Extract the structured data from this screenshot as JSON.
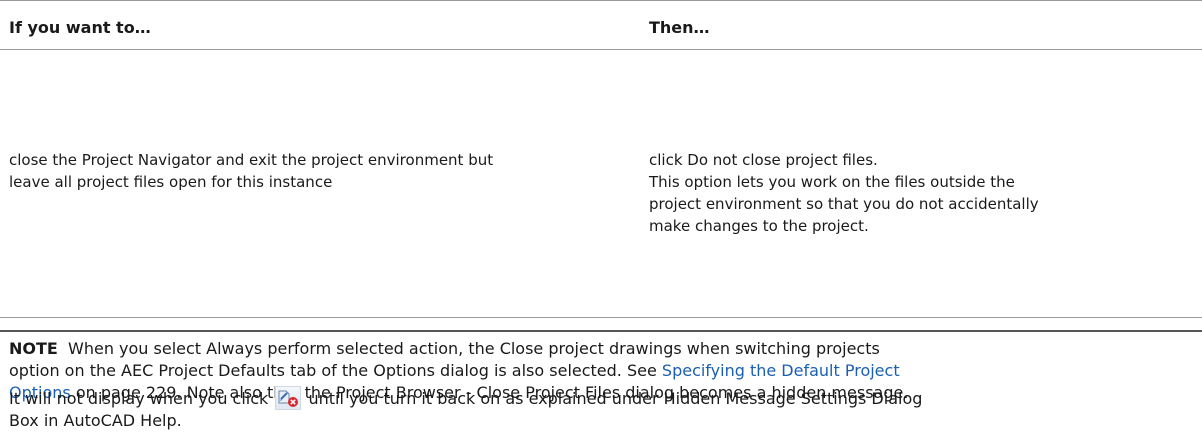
{
  "table": {
    "header": {
      "col1": "If you want to…",
      "col2": "Then…"
    },
    "row": {
      "col1_lines": [
        "close the Project Navigator and exit the project environment but",
        "leave all project files open for this instance"
      ],
      "col2_lines": [
        "click Do not close project files.",
        "This option lets you work on the files outside the",
        "project environment so that you do not accidentally",
        "make changes to the project."
      ]
    }
  },
  "note": {
    "label": "NOTE",
    "line1": "When you select Always perform selected action, the Close project drawings when switching projects",
    "line2a": "option on the AEC Project Defaults tab of the Options dialog is also selected. See ",
    "link1": "Specifying the Default Project",
    "link2": "Options",
    "line3b": " on page 229. Note also that the Project Browser - Close Project Files dialog becomes a hidden message."
  },
  "after": {
    "part1": "It will not display when you click ",
    "part2": " until you turn it back on as explained under Hidden Message Settings Dialog",
    "line2": "Box in AutoCAD Help.",
    "icon": "close-project-icon"
  }
}
